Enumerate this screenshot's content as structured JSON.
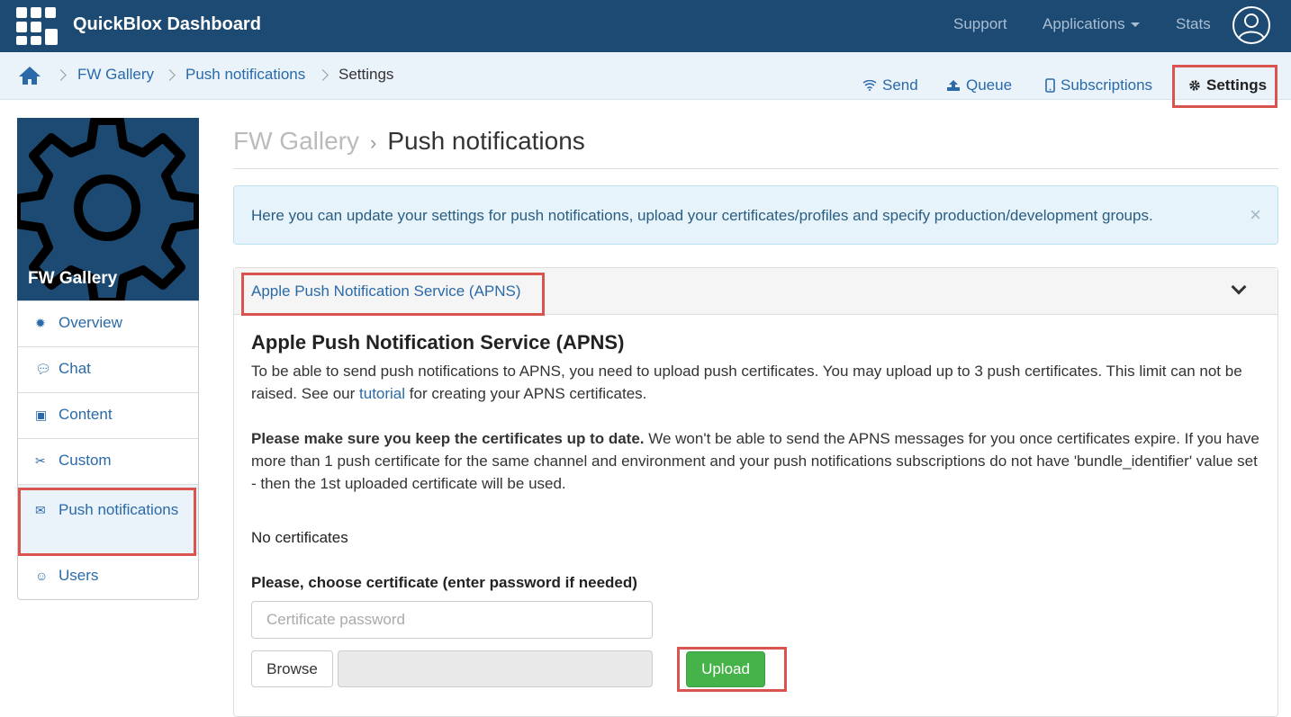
{
  "app": {
    "title": "QuickBlox Dashboard"
  },
  "topnav": {
    "support": "Support",
    "applications": "Applications",
    "stats": "Stats"
  },
  "breadcrumb": {
    "app": "FW Gallery",
    "section": "Push notifications",
    "current": "Settings"
  },
  "tabs": {
    "send": "Send",
    "queue": "Queue",
    "subscriptions": "Subscriptions",
    "settings": "Settings"
  },
  "sidebar": {
    "app_name": "FW Gallery",
    "items": [
      {
        "label": "Overview",
        "icon": "gear-icon"
      },
      {
        "label": "Chat",
        "icon": "chat-icon"
      },
      {
        "label": "Content",
        "icon": "content-icon"
      },
      {
        "label": "Custom",
        "icon": "custom-icon"
      },
      {
        "label": "Push notifications",
        "icon": "envelope-icon"
      },
      {
        "label": "Users",
        "icon": "users-icon"
      }
    ]
  },
  "main": {
    "title_app": "FW Gallery",
    "title_page": "Push notifications",
    "alert": "Here you can update your settings for push notifications, upload your certificates/profiles and specify production/development groups.",
    "panel": {
      "header_link": "Apple Push Notification Service (APNS)",
      "heading": "Apple Push Notification Service (APNS)",
      "para1_before": "To be able to send push notifications to APNS, you need to upload push certificates. You may upload up to 3 push certificates. This limit can not be raised. See our ",
      "para1_link": "tutorial",
      "para1_after": " for creating your APNS certificates.",
      "para2_bold": "Please make sure you keep the certificates up to date.",
      "para2_rest": " We won't be able to send the APNS messages for you once certificates expire. If you have more than 1 push certificate for the same channel and environment and your push notifications subscriptions do not have 'bundle_identifier' value set - then the 1st uploaded certificate will be used.",
      "no_certs": "No certificates",
      "choose_label": "Please, choose certificate (enter password if needed)",
      "password_placeholder": "Certificate password",
      "browse_label": "Browse",
      "upload_label": "Upload"
    }
  },
  "colors": {
    "navbar": "#1d4a73",
    "link": "#2a6aa8",
    "highlight": "#d9534f",
    "upload": "#46b34a"
  }
}
